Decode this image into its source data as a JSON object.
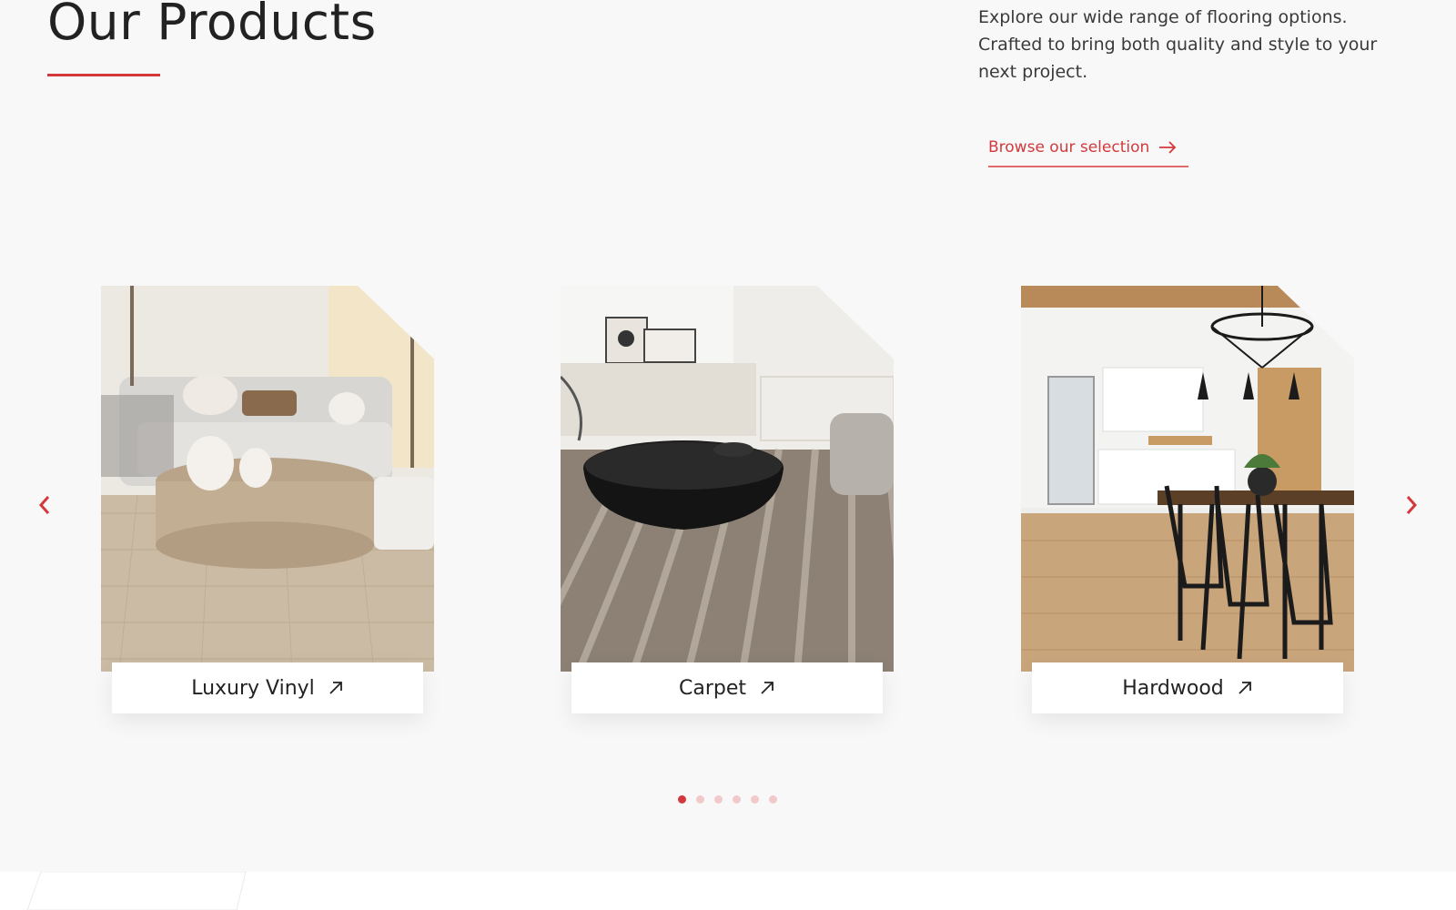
{
  "header": {
    "title": "Our Products",
    "intro": "Explore our wide range of flooring options. Crafted to bring both quality and style to your next project.",
    "browse_label": "Browse our selection"
  },
  "carousel": {
    "prev_icon": "chevron-left-icon",
    "next_icon": "chevron-right-icon",
    "cards": [
      {
        "label": "Luxury Vinyl",
        "icon": "arrow-up-right-icon"
      },
      {
        "label": "Carpet",
        "icon": "arrow-up-right-icon"
      },
      {
        "label": "Hardwood",
        "icon": "arrow-up-right-icon"
      }
    ],
    "dots_total": 6,
    "active_dot": 1
  },
  "colors": {
    "accent": "#d3393c",
    "background": "#f8f8f8",
    "text": "#222222"
  }
}
